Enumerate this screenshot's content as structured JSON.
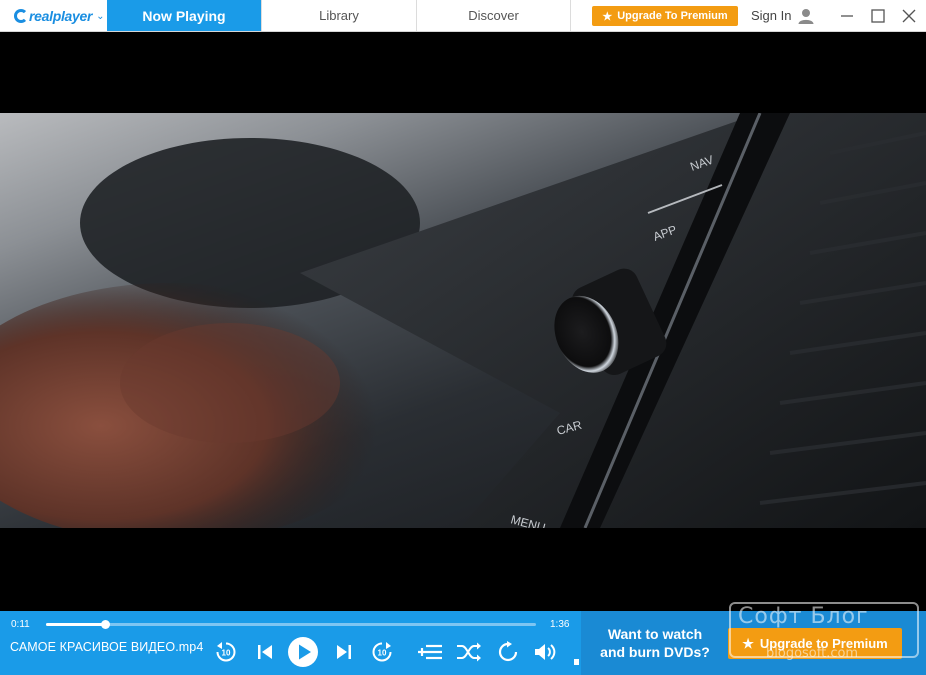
{
  "app": {
    "logo_text": "realplayer"
  },
  "tabs": {
    "now_playing": "Now Playing",
    "library": "Library",
    "discover": "Discover"
  },
  "header": {
    "upgrade_label": "Upgrade To Premium",
    "signin_label": "Sign In"
  },
  "video": {
    "screen_labels": [
      "NAV",
      "APP",
      "CAR",
      "MENU"
    ]
  },
  "player": {
    "current_time": "0:11",
    "total_time": "1:36",
    "progress": 0.12,
    "filename": "САМОЕ КРАСИВОЕ ВИДЕО.mp4",
    "skip_seconds": "10"
  },
  "promo": {
    "text": "Want to watch and burn DVDs?",
    "button_label": "Upgrade to Premium"
  },
  "watermark": {
    "title": "Софт Блог",
    "subtitle": "blogosoft.com"
  },
  "colors": {
    "accent": "#1a9be8",
    "premium": "#f39c12",
    "promo_bg": "#1a8ad4"
  },
  "icons": {
    "user": "user-icon",
    "minimize": "minimize-icon",
    "maximize": "maximize-icon",
    "close": "close-icon",
    "star": "star-icon"
  }
}
